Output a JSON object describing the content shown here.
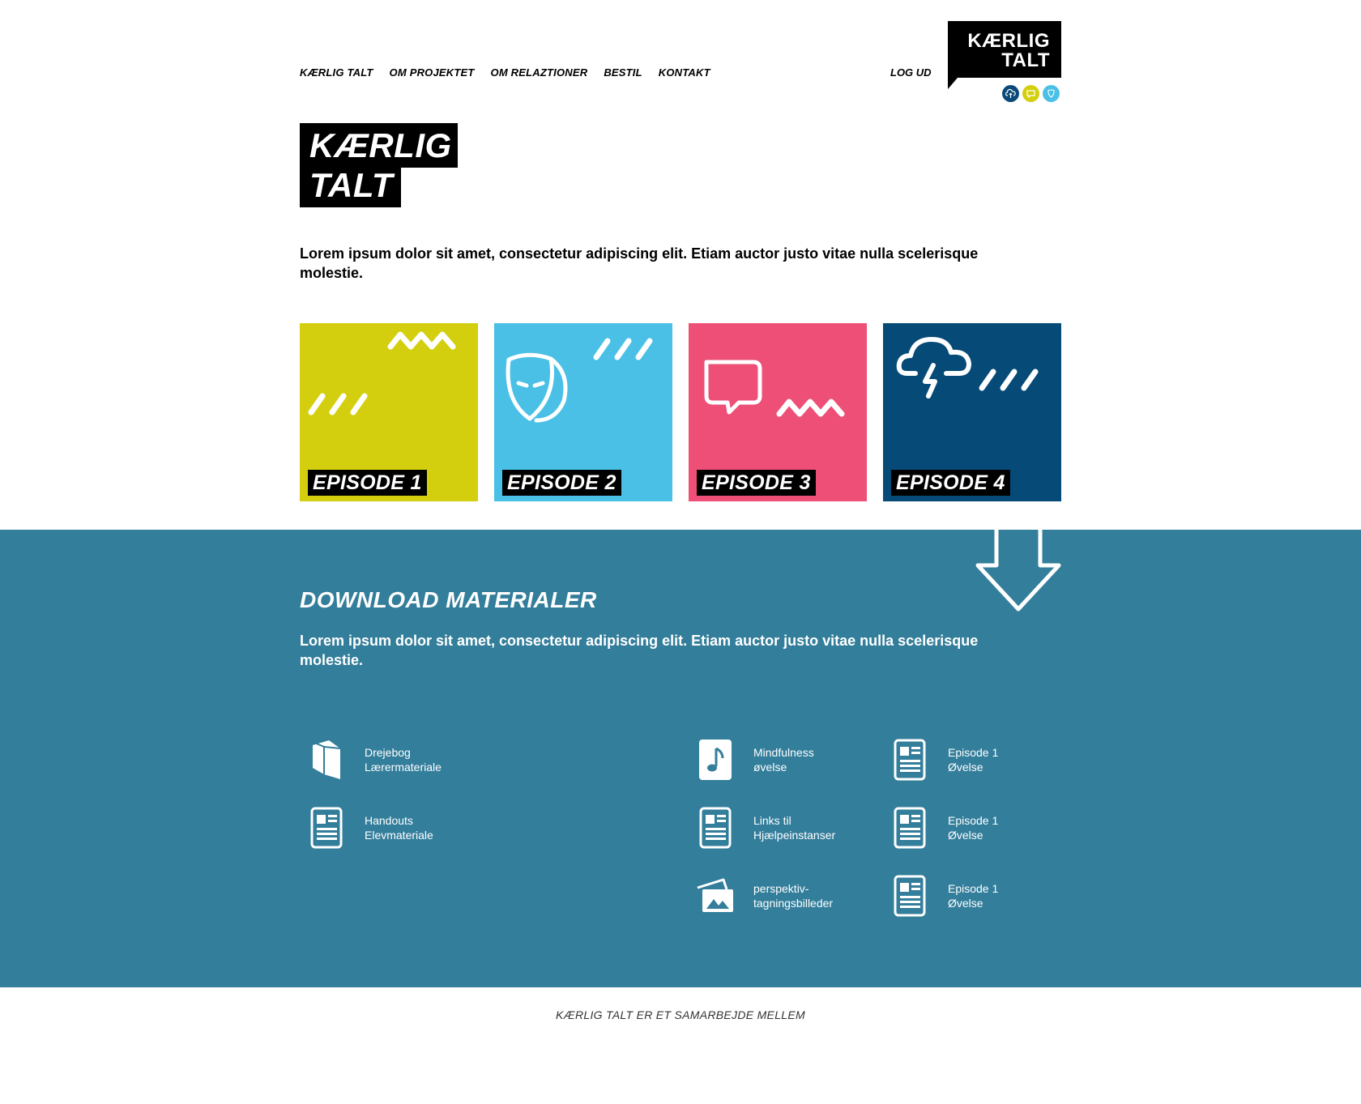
{
  "nav": {
    "items": [
      "KÆRLIG TALT",
      "OM PROJEKTET",
      "OM RELAZTIONER",
      "BESTIL",
      "KONTAKT"
    ],
    "logout": "LOG UD"
  },
  "logo": {
    "line1": "KÆRLIG",
    "line2": "TALT"
  },
  "status_dots": [
    {
      "icon": "cloud-upload-icon",
      "color": "#0b4a78"
    },
    {
      "icon": "speech-bubble-icon",
      "color": "#d4cf0e"
    },
    {
      "icon": "mask-icon",
      "color": "#4ac0e6"
    }
  ],
  "hero": {
    "title_line1": "KÆRLIG",
    "title_line2": "TALT",
    "intro": "Lorem ipsum dolor sit amet, consectetur adipiscing elit. Etiam auctor justo vitae nulla scelerisque molestie."
  },
  "episodes": [
    {
      "label": "EPISODE 1",
      "color": "#d4cf0e",
      "icon": "zigzag-slashes-icon"
    },
    {
      "label": "EPISODE 2",
      "color": "#4ac0e6",
      "icon": "mask-icon"
    },
    {
      "label": "EPISODE 3",
      "color": "#ee4f77",
      "icon": "speech-bubble-icon"
    },
    {
      "label": "EPISODE 4",
      "color": "#064a78",
      "icon": "storm-cloud-icon"
    }
  ],
  "download": {
    "title": "DOWNLOAD MATERIALER",
    "text": "Lorem ipsum dolor sit amet, consectetur adipiscing elit. Etiam auctor justo vitae nulla scelerisque molestie.",
    "background": "#337e9b",
    "items": [
      {
        "icon": "book-icon",
        "line1": "Drejebog",
        "line2": "Lærermateriale"
      },
      {
        "icon": "document-icon",
        "line1": "Handouts",
        "line2": "Elevmateriale"
      },
      {
        "icon": "music-note-icon",
        "line1": "Mindfulness",
        "line2": "øvelse"
      },
      {
        "icon": "document-icon",
        "line1": "Links til",
        "line2": "Hjælpeinstanser"
      },
      {
        "icon": "photos-icon",
        "line1": "perspektiv-",
        "line2": "tagningsbilleder"
      },
      {
        "icon": "document-icon",
        "line1": "Episode 1",
        "line2": "Øvelse"
      },
      {
        "icon": "document-icon",
        "line1": "Episode 1",
        "line2": "Øvelse"
      },
      {
        "icon": "document-icon",
        "line1": "Episode 1",
        "line2": "Øvelse"
      }
    ]
  },
  "footer": {
    "text": "KÆRLIG TALT ER ET SAMARBEJDE MELLEM"
  }
}
